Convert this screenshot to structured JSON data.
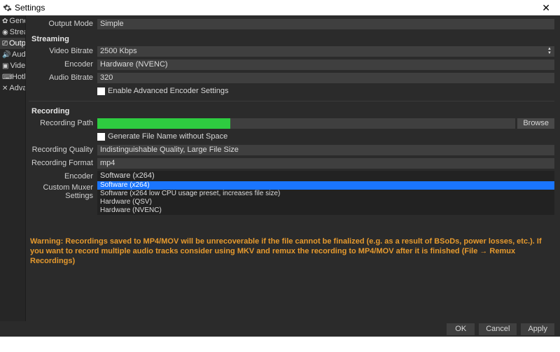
{
  "window": {
    "title": "Settings",
    "close_glyph": "✕"
  },
  "sidebar": {
    "items": [
      {
        "icon": "✿",
        "label": "General"
      },
      {
        "icon": "◉",
        "label": "Stream"
      },
      {
        "icon": "⎚",
        "label": "Output"
      },
      {
        "icon": "🔊",
        "label": "Audio"
      },
      {
        "icon": "▣",
        "label": "Video"
      },
      {
        "icon": "⌨",
        "label": "Hotkeys"
      },
      {
        "icon": "✕",
        "label": "Advanced"
      }
    ]
  },
  "output_mode": {
    "label": "Output Mode",
    "value": "Simple"
  },
  "streaming": {
    "heading": "Streaming",
    "video_bitrate": {
      "label": "Video Bitrate",
      "value": "2500 Kbps"
    },
    "encoder": {
      "label": "Encoder",
      "value": "Hardware (NVENC)"
    },
    "audio_bitrate": {
      "label": "Audio Bitrate",
      "value": "320"
    },
    "advanced_checkbox_label": "Enable Advanced Encoder Settings"
  },
  "recording": {
    "heading": "Recording",
    "path": {
      "label": "Recording Path",
      "browse": "Browse"
    },
    "gen_filename_label": "Generate File Name without Space",
    "quality": {
      "label": "Recording Quality",
      "value": "Indistinguishable Quality, Large File Size"
    },
    "format": {
      "label": "Recording Format",
      "value": "mp4"
    },
    "encoder": {
      "label": "Encoder",
      "selected": "Software (x264)",
      "options": [
        "Software (x264)",
        "Software (x264 low CPU usage preset, increases file size)",
        "Hardware (QSV)",
        "Hardware (NVENC)"
      ],
      "highlight_index": 0
    },
    "muxer": {
      "label": "Custom Muxer Settings"
    }
  },
  "warning_text": "Warning: Recordings saved to MP4/MOV will be unrecoverable if the file cannot be finalized (e.g. as a result of BSoDs, power losses, etc.). If you want to record multiple audio tracks consider using MKV and remux the recording to MP4/MOV after it is finished (File → Remux Recordings)",
  "footer": {
    "ok": "OK",
    "cancel": "Cancel",
    "apply": "Apply"
  }
}
